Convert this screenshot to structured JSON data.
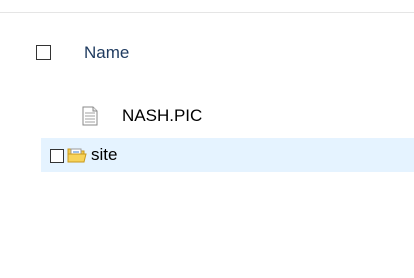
{
  "header": {
    "name_label": "Name"
  },
  "files": [
    {
      "name": "NASH.PIC",
      "icon": "text-file-icon"
    },
    {
      "name": "site",
      "icon": "folder-icon"
    }
  ],
  "colors": {
    "selection_bg": "#e5f3ff",
    "header_text": "#1e3a5f",
    "divider": "#e5e5e5"
  }
}
